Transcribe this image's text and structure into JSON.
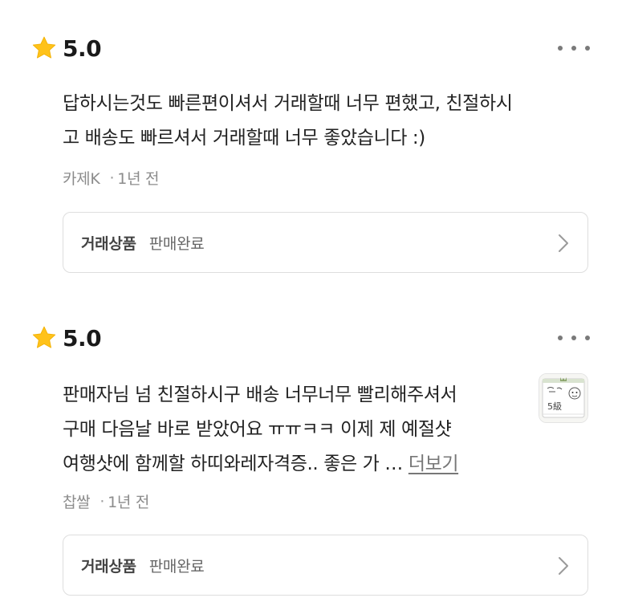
{
  "reviews": [
    {
      "rating": "5.0",
      "text_lines": [
        "답하시는것도 빠른편이셔서 거래할때 너무 편했고, 친절하시",
        "고 배송도 빠르셔서 거래할때 너무 좋았습니다 :)"
      ],
      "author": "카제K",
      "separator": "·",
      "time": "1년 전",
      "trade_label": "거래상품",
      "trade_status": "판매완료"
    },
    {
      "rating": "5.0",
      "text_lines": [
        "판매자님 넘 친절하시구 배송 너무너무 빨리해주셔서",
        "구매 다음날 바로 받았어요 ㅠㅠㅋㅋ 이제 제 예절샷",
        "여행샷에 함께할 하띠와레자격증.. 좋은 가 … "
      ],
      "more_label": "더보기",
      "thumbnail_label": "5級",
      "author": "찹쌀",
      "separator": "·",
      "time": "1년 전",
      "trade_label": "거래상품",
      "trade_status": "판매완료"
    }
  ],
  "colors": {
    "star": "#FFC21A",
    "border": "#DEDEDE",
    "meta_text": "#8C8C8C"
  },
  "icons": {
    "rating": "star-icon",
    "more": "more-horizontal-icon",
    "chevron": "chevron-right-icon"
  }
}
